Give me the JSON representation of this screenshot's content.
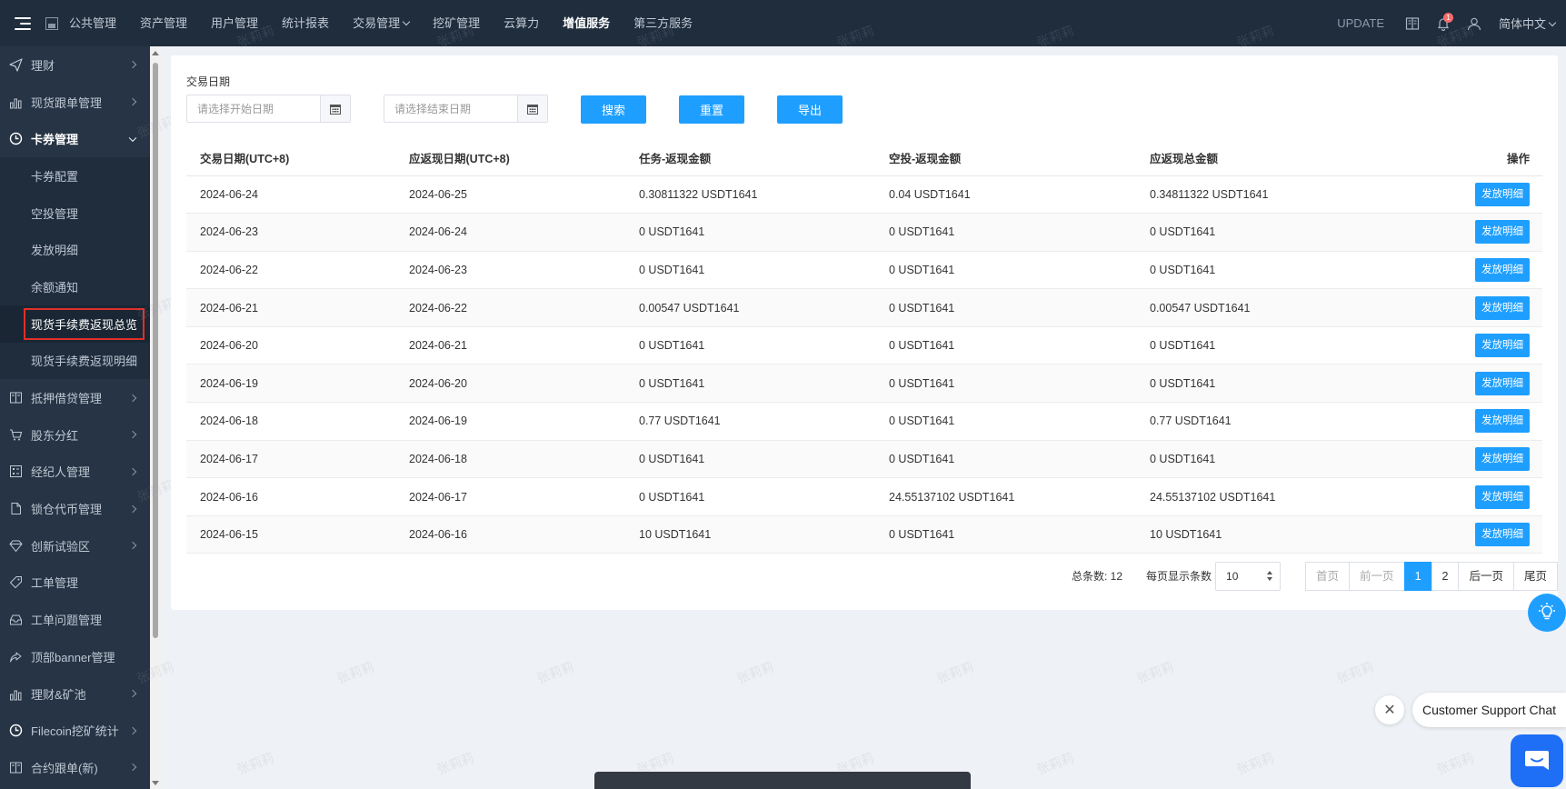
{
  "topbar": {
    "nav": [
      {
        "label": "公共管理",
        "active": false,
        "dropdown": false
      },
      {
        "label": "资产管理",
        "active": false,
        "dropdown": false
      },
      {
        "label": "用户管理",
        "active": false,
        "dropdown": false
      },
      {
        "label": "统计报表",
        "active": false,
        "dropdown": false
      },
      {
        "label": "交易管理",
        "active": false,
        "dropdown": true
      },
      {
        "label": "挖矿管理",
        "active": false,
        "dropdown": false
      },
      {
        "label": "云算力",
        "active": false,
        "dropdown": false
      },
      {
        "label": "增值服务",
        "active": true,
        "dropdown": false
      },
      {
        "label": "第三方服务",
        "active": false,
        "dropdown": false
      }
    ],
    "update_label": "UPDATE",
    "notification_count": "1",
    "language": "简体中文"
  },
  "sidebar": {
    "items_before": [
      {
        "label": "理财",
        "icon": "send-icon"
      },
      {
        "label": "现货跟单管理",
        "icon": "bar-chart-icon"
      }
    ],
    "open_group": {
      "label": "卡券管理",
      "icon": "clock-icon"
    },
    "sub_items": [
      {
        "label": "卡券配置",
        "current": false
      },
      {
        "label": "空投管理",
        "current": false
      },
      {
        "label": "发放明细",
        "current": false
      },
      {
        "label": "余额通知",
        "current": false
      },
      {
        "label": "现货手续费返现总览",
        "current": true
      },
      {
        "label": "现货手续费返现明细",
        "current": false
      }
    ],
    "items_after": [
      {
        "label": "抵押借贷管理",
        "icon": "book-icon",
        "arrow": true
      },
      {
        "label": "股东分红",
        "icon": "cart-icon",
        "arrow": true
      },
      {
        "label": "经纪人管理",
        "icon": "dashboard-icon",
        "arrow": true
      },
      {
        "label": "锁仓代币管理",
        "icon": "document-icon",
        "arrow": true
      },
      {
        "label": "创新试验区",
        "icon": "diamond-icon",
        "arrow": true
      },
      {
        "label": "工单管理",
        "icon": "tag-icon",
        "arrow": false
      },
      {
        "label": "工单问题管理",
        "icon": "inbox-icon",
        "arrow": false
      },
      {
        "label": "顶部banner管理",
        "icon": "share-icon",
        "arrow": false
      },
      {
        "label": "理财&矿池",
        "icon": "bar-chart-icon",
        "arrow": true
      },
      {
        "label": "Filecoin挖矿统计",
        "icon": "clock-icon",
        "arrow": true
      },
      {
        "label": "合约跟单(新)",
        "icon": "book-icon",
        "arrow": true
      }
    ]
  },
  "filters": {
    "label": "交易日期",
    "start_placeholder": "请选择开始日期",
    "end_placeholder": "请选择结束日期",
    "search_label": "搜索",
    "reset_label": "重置",
    "export_label": "导出"
  },
  "table": {
    "headers": [
      "交易日期(UTC+8)",
      "应返现日期(UTC+8)",
      "任务-返现金额",
      "空投-返现金额",
      "应返现总金额",
      "操作"
    ],
    "action_label": "发放明细",
    "rows": [
      [
        "2024-06-24",
        "2024-06-25",
        "0.30811322 USDT1641",
        "0.04 USDT1641",
        "0.34811322 USDT1641"
      ],
      [
        "2024-06-23",
        "2024-06-24",
        "0 USDT1641",
        "0 USDT1641",
        "0 USDT1641"
      ],
      [
        "2024-06-22",
        "2024-06-23",
        "0 USDT1641",
        "0 USDT1641",
        "0 USDT1641"
      ],
      [
        "2024-06-21",
        "2024-06-22",
        "0.00547 USDT1641",
        "0 USDT1641",
        "0.00547 USDT1641"
      ],
      [
        "2024-06-20",
        "2024-06-21",
        "0 USDT1641",
        "0 USDT1641",
        "0 USDT1641"
      ],
      [
        "2024-06-19",
        "2024-06-20",
        "0 USDT1641",
        "0 USDT1641",
        "0 USDT1641"
      ],
      [
        "2024-06-18",
        "2024-06-19",
        "0.77 USDT1641",
        "0 USDT1641",
        "0.77 USDT1641"
      ],
      [
        "2024-06-17",
        "2024-06-18",
        "0 USDT1641",
        "0 USDT1641",
        "0 USDT1641"
      ],
      [
        "2024-06-16",
        "2024-06-17",
        "0 USDT1641",
        "24.55137102 USDT1641",
        "24.55137102 USDT1641"
      ],
      [
        "2024-06-15",
        "2024-06-16",
        "10 USDT1641",
        "0 USDT1641",
        "10 USDT1641"
      ]
    ]
  },
  "pagination": {
    "total_label": "总条数:",
    "total_value": "12",
    "per_page_label": "每页显示条数",
    "per_page_value": "10",
    "first": "首页",
    "prev": "前一页",
    "pages": [
      "1",
      "2"
    ],
    "current_page": "1",
    "next": "后一页",
    "last": "尾页"
  },
  "watermark_text": "张莉莉",
  "chat": {
    "label": "Customer Support Chat",
    "close_glyph": "✕"
  },
  "colors": {
    "topbar_bg": "#1f2d3d",
    "sidebar_bg": "#263445",
    "primary": "#1e9fff",
    "highlight_border": "#e0302a"
  }
}
